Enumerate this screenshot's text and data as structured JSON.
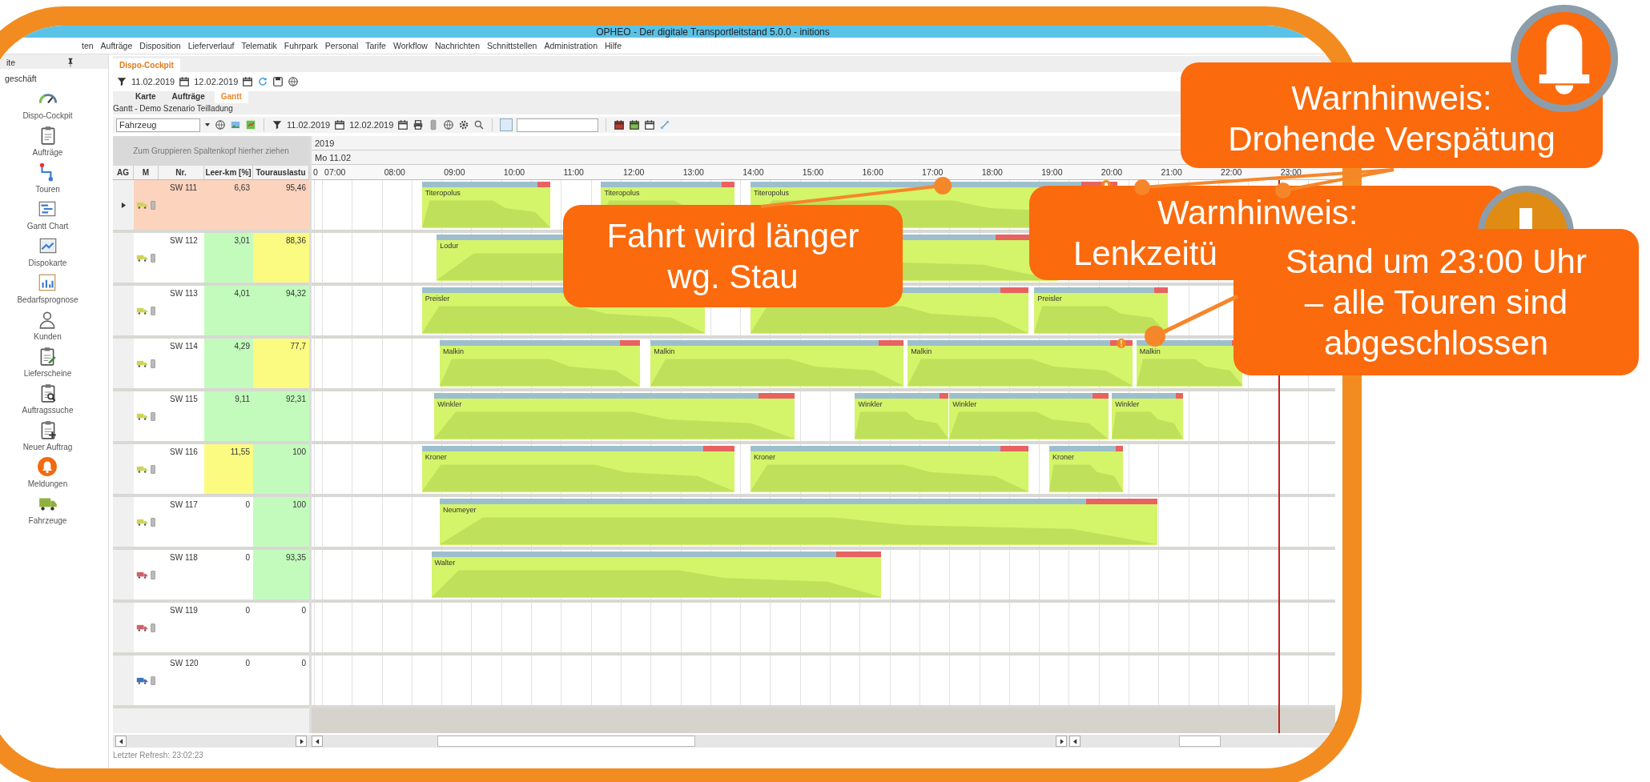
{
  "window": {
    "title": "OPHEO - Der digitale Transportleitstand 5.0.0  - initions"
  },
  "menu": [
    "ten",
    "Aufträge",
    "Disposition",
    "Lieferverlauf",
    "Telematik",
    "Fuhrpark",
    "Personal",
    "Tarife",
    "Workflow",
    "Nachrichten",
    "Schnittstellen",
    "Administration",
    "Hilfe"
  ],
  "sidebar": {
    "header": "ite",
    "group": "geschäft",
    "items": [
      {
        "label": "Dispo-Cockpit",
        "kind": "gauge"
      },
      {
        "label": "Aufträge",
        "kind": "clipboard"
      },
      {
        "label": "Touren",
        "kind": "route"
      },
      {
        "label": "Gantt Chart",
        "kind": "gantt"
      },
      {
        "label": "Dispokarte",
        "kind": "map"
      },
      {
        "label": "Bedarfsprognose",
        "kind": "chart"
      },
      {
        "label": "Kunden",
        "kind": "person"
      },
      {
        "label": "Lieferscheine",
        "kind": "doc_pen"
      },
      {
        "label": "Auftragssuche",
        "kind": "doc_search"
      },
      {
        "label": "Neuer Auftrag",
        "kind": "doc_plus"
      },
      {
        "label": "Meldungen",
        "kind": "alert"
      },
      {
        "label": "Fahrzeuge",
        "kind": "truck"
      }
    ]
  },
  "document_tab": {
    "label": "Dispo-Cockpit",
    "selected": true
  },
  "filter_bar": {
    "from": "11.02.2019",
    "to": "12.02.2019"
  },
  "view_tabs": [
    {
      "label": "Karte",
      "selected": false
    },
    {
      "label": "Aufträge",
      "selected": false
    },
    {
      "label": "Gantt",
      "selected": true
    }
  ],
  "gantt_title": "Gantt - Demo Szenario Teilladung",
  "toolbar": {
    "group_by": "Fahrzeug",
    "from": "11.02.2019",
    "to": "12.02.2019"
  },
  "table": {
    "group_hint": "Zum Gruppieren Spaltenkopf hierher ziehen",
    "columns": [
      "AG",
      "M",
      "Nr.",
      "Leer-km [%]",
      "Tourauslastu"
    ]
  },
  "timeline": {
    "year": "2019",
    "day": "Mo 11.02",
    "cut_label": "0",
    "hours": [
      {
        "label": "07:00",
        "now": false
      },
      {
        "label": "08:00",
        "now": false
      },
      {
        "label": "09:00",
        "now": false
      },
      {
        "label": "10:00",
        "now": false
      },
      {
        "label": "11:00",
        "now": false
      },
      {
        "label": "12:00",
        "now": false
      },
      {
        "label": "13:00",
        "now": false
      },
      {
        "label": "14:00",
        "now": false
      },
      {
        "label": "15:00",
        "now": false
      },
      {
        "label": "16:00",
        "now": false
      },
      {
        "label": "17:00",
        "now": false
      },
      {
        "label": "18:00",
        "now": false
      },
      {
        "label": "19:00",
        "now": false
      },
      {
        "label": "20:00",
        "now": false
      },
      {
        "label": "21:00",
        "now": false
      },
      {
        "label": "22:00",
        "now": false
      },
      {
        "label": "23:00",
        "now": true
      }
    ]
  },
  "rows": [
    {
      "nr": "SW 111",
      "leer_km": {
        "text": "6,63"
      },
      "auslastung": {
        "text": "95,46"
      },
      "selected": true,
      "truck": {
        "color": "#cfd35a"
      },
      "tours": [
        {
          "driver": "Titeropolus",
          "kind": "plain"
        },
        {
          "driver": "Titeropolus",
          "kind": "plain"
        },
        {
          "driver": "Titeropolus",
          "kind": "bell"
        }
      ]
    },
    {
      "nr": "SW 112",
      "leer_km": {
        "text": "3,01",
        "color": "#c3fbbd"
      },
      "auslastung": {
        "text": "88,36",
        "color": "#fbfb82"
      },
      "selected": false,
      "truck": {
        "color": "#cfd35a"
      },
      "tours": [
        {
          "driver": "Lodur",
          "kind": "plain"
        }
      ]
    },
    {
      "nr": "SW 113",
      "leer_km": {
        "text": "4,01",
        "color": "#c3fbbd"
      },
      "auslastung": {
        "text": "94,32",
        "color": "#c3fbbd"
      },
      "selected": false,
      "truck": {
        "color": "#cfd35a"
      },
      "tours": [
        {
          "driver": "Preisler",
          "kind": "plain"
        },
        {
          "kind": "plain"
        },
        {
          "driver": "Preisler",
          "kind": "plain"
        }
      ]
    },
    {
      "nr": "SW 114",
      "leer_km": {
        "text": "4,29",
        "color": "#c3fbbd"
      },
      "auslastung": {
        "text": "77,7",
        "color": "#fbfb82"
      },
      "selected": false,
      "truck": {
        "color": "#cfd35a"
      },
      "tours": [
        {
          "driver": "Malkin",
          "kind": "plain"
        },
        {
          "driver": "Malkin",
          "kind": "plain"
        },
        {
          "driver": "Malkin",
          "kind": "alert"
        },
        {
          "driver": "Malkin",
          "kind": "plain"
        }
      ]
    },
    {
      "nr": "SW 115",
      "leer_km": {
        "text": "9,11",
        "color": "#c3fbbd"
      },
      "auslastung": {
        "text": "92,31",
        "color": "#c3fbbd"
      },
      "selected": false,
      "truck": {
        "color": "#cfd35a"
      },
      "tours": [
        {
          "driver": "Winkler",
          "kind": "plain"
        },
        {
          "driver": "Winkler",
          "kind": "plain"
        },
        {
          "driver": "Winkler",
          "kind": "plain"
        },
        {
          "driver": "Winkler",
          "kind": "plain"
        }
      ]
    },
    {
      "nr": "SW 116",
      "leer_km": {
        "text": "11,55",
        "color": "#fbfb82"
      },
      "auslastung": {
        "text": "100",
        "color": "#c3fbbd"
      },
      "selected": false,
      "truck": {
        "color": "#cfd35a"
      },
      "tours": [
        {
          "driver": "Kroner",
          "kind": "plain"
        },
        {
          "driver": "Kroner",
          "kind": "plain"
        },
        {
          "driver": "Kroner",
          "kind": "plain"
        }
      ]
    },
    {
      "nr": "SW 117",
      "leer_km": {
        "text": "0"
      },
      "auslastung": {
        "text": "100",
        "color": "#c3fbbd"
      },
      "selected": false,
      "truck": {
        "color": "#cfd35a"
      },
      "tours": [
        {
          "driver": "Neumeyer",
          "kind": "plain"
        }
      ]
    },
    {
      "nr": "SW 118",
      "leer_km": {
        "text": "0"
      },
      "auslastung": {
        "text": "93,35",
        "color": "#c3fbbd"
      },
      "selected": false,
      "truck": {
        "color": "#d0606a"
      },
      "tours": [
        {
          "driver": "Walter",
          "kind": "plain"
        }
      ]
    },
    {
      "nr": "SW 119",
      "leer_km": {
        "text": "0"
      },
      "auslastung": {
        "text": "0"
      },
      "selected": false,
      "truck": {
        "color": "#d0606a"
      }
    },
    {
      "nr": "SW 120",
      "leer_km": {
        "text": "0"
      },
      "auslastung": {
        "text": "0"
      },
      "selected": false,
      "truck": {
        "color": "#3f72b8"
      }
    }
  ],
  "status_bar": "Letzter Refresh: 23:02:23",
  "callouts": [
    {
      "kind": "stau",
      "lines": [
        "Fahrt wird länger",
        "wg. Stau"
      ]
    },
    {
      "kind": "delay",
      "lines": [
        "Warnhinweis:",
        "Drohende Verspätung"
      ]
    },
    {
      "kind": "drive_time",
      "lines": [
        "Warnhinweis:",
        "Lenkzeitü"
      ]
    },
    {
      "kind": "done",
      "lines": [
        "Stand um 23:00 Uhr",
        "– alle Touren sind",
        "abgeschlossen"
      ]
    }
  ]
}
